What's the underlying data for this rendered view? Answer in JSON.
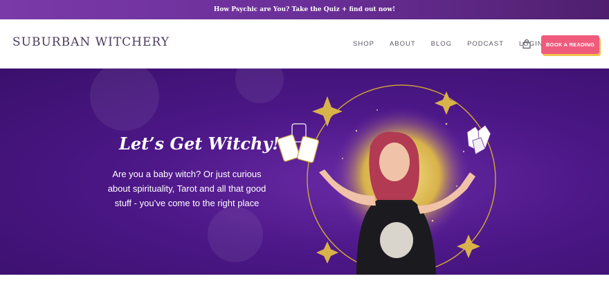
{
  "announcement": {
    "text": "How Psychic are You? Take the Quiz + find out now!"
  },
  "header": {
    "logo": "SUBURBAN WITCHERY",
    "nav": [
      "SHOP",
      "ABOUT",
      "BLOG",
      "PODCAST",
      "LOGIN"
    ],
    "cta": "BOOK A READING",
    "cart_icon": "shopping-bag-icon"
  },
  "hero": {
    "title": "Let’s Get Witchy!",
    "body": "Are you a baby witch? Or just curious about spirituality, Tarot and all that good stuff - you’ve come to the right place"
  },
  "colors": {
    "announce_bg": "#6b2f99",
    "hero_bg": "#4c1787",
    "cta_bg": "#ef5b7d",
    "cta_shadow": "#f3c24b",
    "gold": "#d8b24a"
  }
}
